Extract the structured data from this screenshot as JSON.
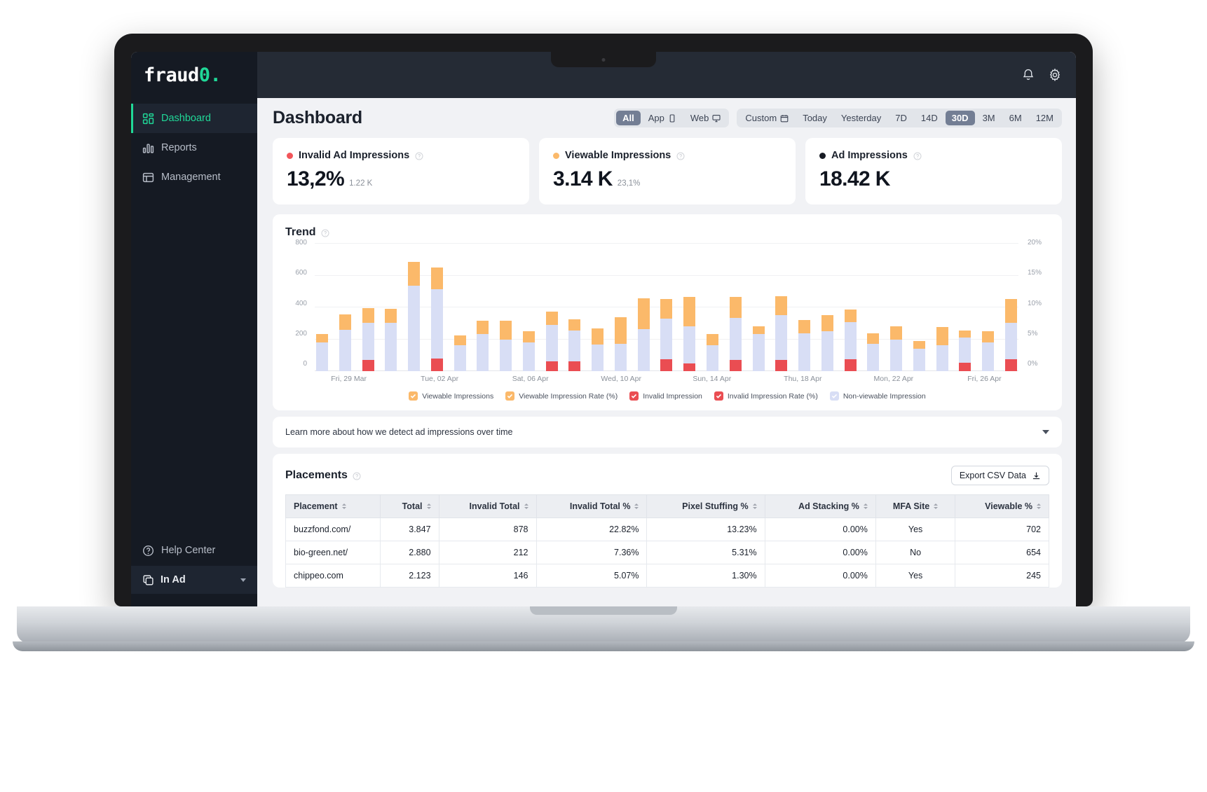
{
  "sidebar": {
    "brand": {
      "text": "fraud",
      "accent": "0",
      "suffix": "."
    },
    "items": [
      {
        "label": "Dashboard",
        "icon": "grid-icon"
      },
      {
        "label": "Reports",
        "icon": "bar-chart-icon"
      },
      {
        "label": "Management",
        "icon": "layout-icon"
      }
    ],
    "help": {
      "label": "Help Center",
      "icon": "question-circle-icon"
    },
    "account": {
      "label": "In Ad",
      "icon": "copy-icon"
    }
  },
  "topbar": {
    "bell": "bell-icon",
    "gear": "gear-icon"
  },
  "header": {
    "title": "Dashboard"
  },
  "filters": {
    "platform": [
      {
        "label": "All",
        "selected": true
      },
      {
        "label": "App",
        "icon": "mobile-icon",
        "selected": false
      },
      {
        "label": "Web",
        "icon": "desktop-icon",
        "selected": false
      }
    ],
    "range": [
      {
        "label": "Custom",
        "icon": "calendar-icon",
        "selected": false
      },
      {
        "label": "Today",
        "selected": false
      },
      {
        "label": "Yesterday",
        "selected": false
      },
      {
        "label": "7D",
        "selected": false
      },
      {
        "label": "14D",
        "selected": false
      },
      {
        "label": "30D",
        "selected": true
      },
      {
        "label": "3M",
        "selected": false
      },
      {
        "label": "6M",
        "selected": false
      },
      {
        "label": "12M",
        "selected": false
      }
    ]
  },
  "kpis": [
    {
      "label": "Invalid Ad Impressions",
      "value": "13,2%",
      "sub": "1.22 K",
      "color": "#f2555a"
    },
    {
      "label": "Viewable Impressions",
      "value": "3.14 K",
      "sub": "23,1%",
      "color": "#fbb96a"
    },
    {
      "label": "Ad Impressions",
      "value": "18.42 K",
      "sub": "",
      "color": "#171b24"
    }
  ],
  "trend": {
    "title": "Trend"
  },
  "chart_data": {
    "type": "bar",
    "title": "Trend",
    "stacked": true,
    "xlabel": "",
    "ylabel": "",
    "ylim": [
      0,
      800
    ],
    "y2lim": [
      0,
      20
    ],
    "yticks": [
      "800",
      "600",
      "400",
      "200",
      "0"
    ],
    "y2ticks": [
      "20%",
      "15%",
      "10%",
      "5%",
      "0%"
    ],
    "grid": true,
    "legend_position": "bottom",
    "tick_labels": [
      "Fri, 29 Mar",
      "Tue, 02 Apr",
      "Sat, 06 Apr",
      "Wed, 10 Apr",
      "Sun, 14 Apr",
      "Thu, 18 Apr",
      "Mon, 22 Apr",
      "Fri, 26 Apr"
    ],
    "tick_indices": [
      1,
      5,
      9,
      13,
      17,
      21,
      25,
      29
    ],
    "legend": [
      {
        "name": "Viewable Impressions",
        "color": "#fbb96a",
        "checked": true
      },
      {
        "name": "Viewable Impression Rate (%)",
        "color": "#fbb96a",
        "checked": true
      },
      {
        "name": "Invalid Impression",
        "color": "#ea4d52",
        "checked": true
      },
      {
        "name": "Invalid Impression Rate  (%)",
        "color": "#ea4d52",
        "checked": true
      },
      {
        "name": "Non-viewable Impression",
        "color": "#d8def5",
        "checked": true
      }
    ],
    "series": [
      {
        "name": "Invalid Impression",
        "color": "#ea4d52",
        "values": [
          0,
          0,
          72,
          0,
          0,
          80,
          0,
          0,
          0,
          0,
          62,
          60,
          0,
          0,
          0,
          76,
          46,
          0,
          70,
          0,
          72,
          0,
          0,
          76,
          0,
          0,
          0,
          0,
          52,
          0,
          76
        ]
      },
      {
        "name": "Non-viewable Impression",
        "color": "#d8def5",
        "values": [
          178,
          258,
          230,
          300,
          532,
          430,
          160,
          230,
          198,
          178,
          228,
          192,
          168,
          170,
          262,
          254,
          234,
          160,
          264,
          230,
          278,
          238,
          250,
          230,
          172,
          198,
          138,
          164,
          158,
          180,
          224
        ]
      },
      {
        "name": "Viewable Impressions",
        "color": "#fbb96a",
        "values": [
          55,
          95,
          90,
          88,
          148,
          135,
          62,
          85,
          115,
          72,
          82,
          72,
          98,
          168,
          192,
          120,
          184,
          70,
          128,
          50,
          120,
          82,
          100,
          80,
          66,
          84,
          52,
          110,
          42,
          68,
          152
        ]
      }
    ]
  },
  "learn": {
    "text": "Learn more about how we detect ad impressions over time"
  },
  "placements": {
    "title": "Placements",
    "export_label": "Export CSV Data",
    "columns": [
      "Placement",
      "Total",
      "Invalid Total",
      "Invalid Total %",
      "Pixel Stuffing %",
      "Ad Stacking %",
      "MFA Site",
      "Viewable %"
    ],
    "rows": [
      [
        "buzzfond.com/",
        "3.847",
        "878",
        "22.82%",
        "13.23%",
        "0.00%",
        "Yes",
        "702"
      ],
      [
        "bio-green.net/",
        "2.880",
        "212",
        "7.36%",
        "5.31%",
        "0.00%",
        "No",
        "654"
      ],
      [
        "chippeo.com",
        "2.123",
        "146",
        "5.07%",
        "1.30%",
        "0.00%",
        "Yes",
        "245"
      ]
    ]
  }
}
